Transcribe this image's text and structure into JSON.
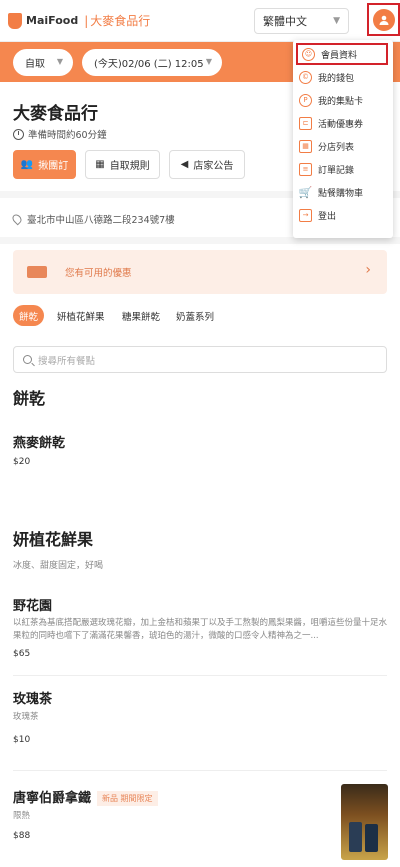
{
  "header": {
    "brand": "MaiFood",
    "store": "大麥食品行",
    "language": "繁體中文"
  },
  "order": {
    "mode": "自取",
    "time": "(今天)02/06 (二) 12:05"
  },
  "store": {
    "name": "大麥食品行",
    "prep": "準備時間約60分鐘",
    "address": "臺北市中山區八德路二段234號7樓"
  },
  "actions": {
    "group": "揪團訂",
    "rules": "自取規則",
    "notice": "店家公告"
  },
  "coupon": {
    "text": "您有可用的優惠"
  },
  "categories": [
    "餅乾",
    "妍植花鮮果",
    "糖果餅乾",
    "奶蓋系列"
  ],
  "search": {
    "placeholder": "搜尋所有餐點"
  },
  "sections": [
    {
      "title": "餅乾",
      "items": [
        {
          "name": "燕麥餅乾",
          "price": "$20"
        }
      ]
    },
    {
      "title": "妍植花鮮果",
      "subtitle": "冰度、甜度固定，好喝",
      "items": [
        {
          "name": "野花園",
          "desc": "以紅茶為基底搭配嚴選玫瑰花瓣，加上金桔和蘋果丁以及手工熬製的鳳梨果醬，咀嚼這些份量十足水果粒的同時也嚐下了滿滿花果馨香，琥珀色的湯汁，微酸的口感令人精神為之一...",
          "price": "$65"
        },
        {
          "name": "玫瑰茶",
          "desc": "玫瑰茶",
          "price": "$10"
        },
        {
          "name": "唐寧伯爵拿鐵",
          "tag": "新品 期間限定",
          "desc": "限熱",
          "price": "$88"
        }
      ]
    }
  ],
  "menu": [
    "會員資料",
    "我的錢包",
    "我的集點卡",
    "活動優惠券",
    "分店列表",
    "訂單記錄",
    "點餐購物車",
    "登出"
  ],
  "colors": {
    "accent": "#f5874f",
    "highlight": "#d3222a"
  }
}
